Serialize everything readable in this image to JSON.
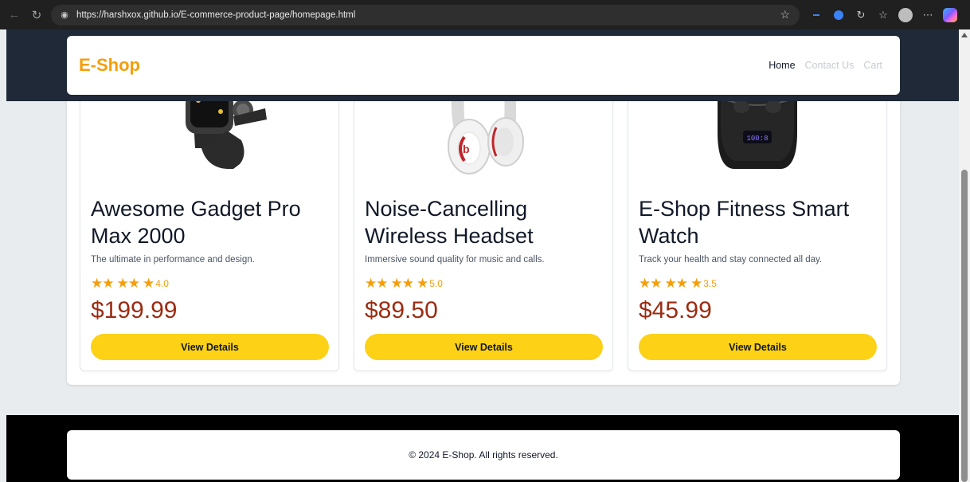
{
  "browser": {
    "url": "https://harshxox.github.io/E-commerce-product-page/homepage.html"
  },
  "site": {
    "brand": "E-Shop",
    "nav": [
      {
        "label": "Home"
      },
      {
        "label": "Contact Us"
      },
      {
        "label": "Cart"
      }
    ]
  },
  "products": [
    {
      "title": "Awesome Gadget Pro Max 2000",
      "description": "The ultimate in performance and design.",
      "rating": "4.0",
      "price": "$199.99",
      "button": "View Details",
      "image_icon": "smartwatch-icon"
    },
    {
      "title": "Noise-Cancelling Wireless Headset",
      "description": "Immersive sound quality for music and calls.",
      "rating": "5.0",
      "price": "$89.50",
      "button": "View Details",
      "image_icon": "headphones-icon"
    },
    {
      "title": "E-Shop Fitness Smart Watch",
      "description": "Track your health and stay connected all day.",
      "rating": "3.5",
      "price": "$45.99",
      "button": "View Details",
      "image_icon": "earbuds-case-icon"
    }
  ],
  "footer": {
    "text": "© 2024 E-Shop. All rights reserved."
  },
  "colors": {
    "brand": "#f59e0b",
    "header_bg": "#1f2937",
    "button_bg": "#fcd116",
    "price": "#9b2c12",
    "star": "#f59e0b"
  }
}
